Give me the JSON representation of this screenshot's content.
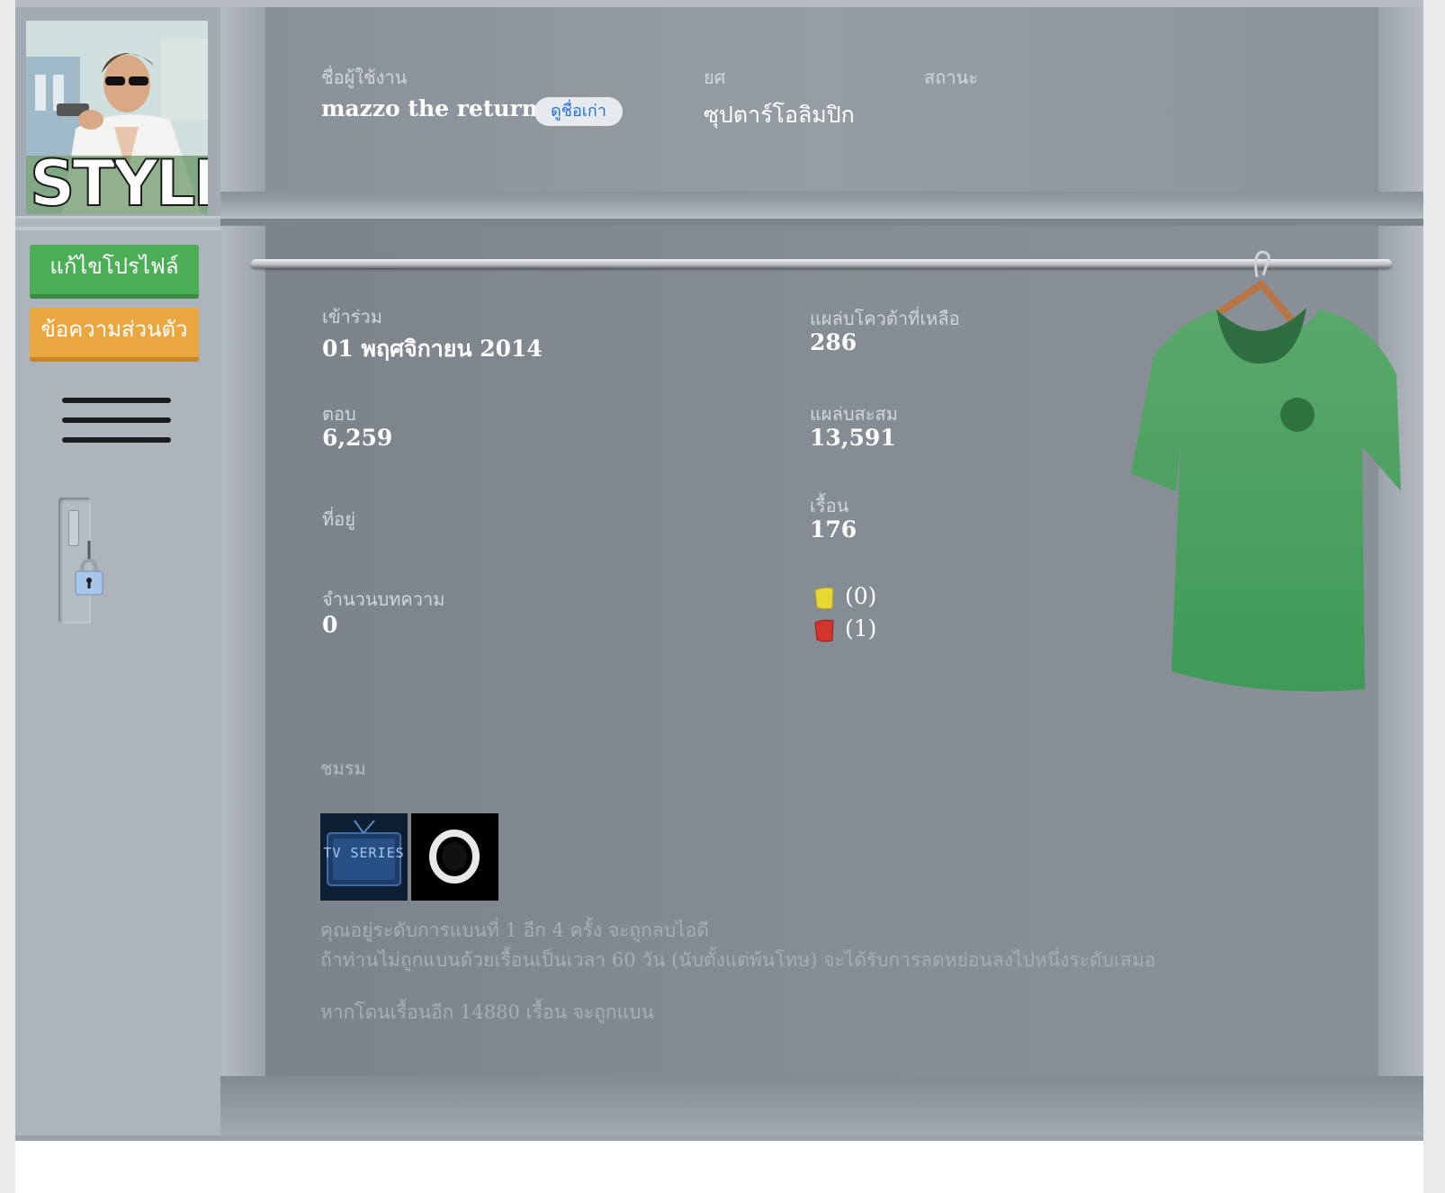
{
  "sidebar": {
    "edit_profile_label": "แก้ไขโปรไฟล์",
    "private_message_label": "ข้อความส่วนตัว",
    "avatar_text": "STYLE"
  },
  "header": {
    "username_label": "ชื่อผู้ใช้งาน",
    "username": "mazzo the returner",
    "old_names_label": "ดูชื่อเก่า",
    "rank_label": "ยศ",
    "rank": "ซุปตาร์โอลิมปิก",
    "status_label": "สถานะ"
  },
  "stats": {
    "joined_label": "เข้าร่วม",
    "joined": "01 พฤศจิกายน 2014",
    "quota_label": "แผล่บโควต้าที่เหลือ",
    "quota": "286",
    "replies_label": "ตอบ",
    "replies": "6,259",
    "accumulated_label": "แผล่บสะสม",
    "accumulated": "13,591",
    "address_label": "ที่อยู่",
    "reun_label": "เรื้อน",
    "reun": "176",
    "articles_label": "จำนวนบทความ",
    "articles": "0",
    "yellow_cards": "(0)",
    "red_cards": "(1)"
  },
  "clubs": {
    "label": "ชมรม",
    "items": [
      {
        "name": "TV SERIES"
      },
      {
        "name": ""
      }
    ]
  },
  "notes": {
    "ban_level": "คุณอยู่ระดับการแบนที่ 1 อีก 4 ครั้ง จะถูกลบไอดี",
    "ban_reduce": "ถ้าท่านไม่ถูกแบนด้วยเรื้อนเป็นเวลา 60 วัน (นับตั้งแต่พ้นโทษ) จะได้รับการลดหย่อนลงไปหนึ่งระดับเสมอ",
    "ban_threshold": "หากโดนเรื้อนอีก 14880 เรื้อน จะถูกแบน"
  },
  "colors": {
    "green_button": "#4cae57",
    "orange_button": "#eba73f",
    "shirt": "#4f9f63",
    "yellow_card": "#e6d735",
    "red_card": "#d2352d"
  },
  "icons": {
    "menu": "hamburger-menu-icon",
    "lock": "padlock-icon",
    "shirt": "green-shirt-icon",
    "yellow_card": "yellow-card-icon",
    "red_card": "red-card-icon"
  }
}
